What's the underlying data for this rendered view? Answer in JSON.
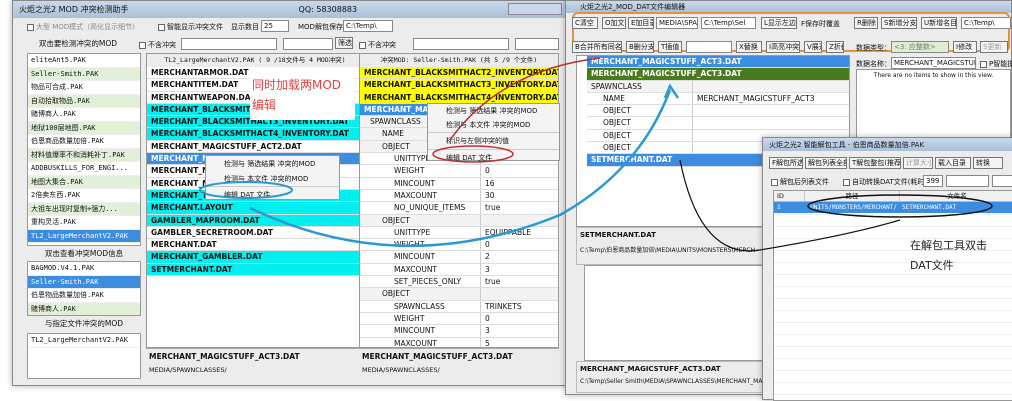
{
  "win1": {
    "title": "火炬之光2 MOD 冲突检测助手",
    "qq": "QQ: 58308883",
    "opt_large": "大型 MOD模式（简化显示细节）",
    "opt_smart": "智能显示冲突文件",
    "show_count_label": "显示数目",
    "show_count": "25",
    "cache_label": "MOD解包保存目录",
    "cache_dir": "C:\\Temp\\",
    "left_header1": "双击要检测冲突的MOD",
    "mods": [
      {
        "t": "eliteAnt5.PAK",
        "g": false
      },
      {
        "t": "Seller-Smith.PAK",
        "g": true
      },
      {
        "t": "物品可合成.PAK",
        "g": false
      },
      {
        "t": "自动拾取物品.PAK",
        "g": true
      },
      {
        "t": "赌博商人.PAK",
        "g": false
      },
      {
        "t": "地狱100层地图.PAK",
        "g": true
      },
      {
        "t": "伯恩商品数量加倍.PAK",
        "g": false
      },
      {
        "t": "材料值爆率不和消耗补丁.PAK",
        "g": true
      },
      {
        "t": "ADDBUSKILLS_FOR_ENGI...",
        "g": false
      },
      {
        "t": "地图大集合.PAK",
        "g": true
      },
      {
        "t": "2倍卖东西.PAK",
        "g": false
      },
      {
        "t": "大祖车出现时复制+强力...",
        "g": true
      },
      {
        "t": "重构灵活.PAK",
        "g": false
      },
      {
        "t": "TL2_LargeMerchantV2.PAK",
        "sel": true
      }
    ],
    "left_header2": "双击查看冲突MOD信息",
    "conflicts": [
      {
        "t": "BAGMOD.V4.1.PAK"
      },
      {
        "t": "Seller-Smith.PAK",
        "sel": true
      },
      {
        "t": "伯恩物品数量加倍.PAK"
      },
      {
        "t": "赌博商人.PAK",
        "g": true
      }
    ],
    "left_header3": "与指定文件冲突的MOD",
    "file_conflicts": [
      "TL2_LargeMerchantV2.PAK"
    ],
    "no_conflict": "不含冲突",
    "filter_btn": "筛选",
    "mid_header": "TL2_LargeMerchantV2.PAK ( 9 /18文件与 4 MOD冲突)",
    "mid_rows": [
      {
        "t": "MERCHANTARMOR.DAT",
        "c": ""
      },
      {
        "t": "MERCHANTITEM.DAT",
        "c": ""
      },
      {
        "t": "MERCHANTWEAPON.DAT",
        "c": ""
      },
      {
        "t": "MERCHANT_BLACKSMITHACT2_INVENTORY.DAT",
        "c": "c"
      },
      {
        "t": "MERCHANT_BLACKSMITHACT3_INVENTORY.DAT",
        "c": "c"
      },
      {
        "t": "MERCHANT_BLACKSMITHACT4_INVENTORY.DAT",
        "c": "c"
      },
      {
        "t": "MERCHANT_MAGICSTUFF_ACT2.DAT",
        "c": ""
      },
      {
        "t": "MERCHANT_MAGICSTUFF_ACT3.DAT",
        "c": "b"
      },
      {
        "t": "MERCHANT_MAPROOM.DAT",
        "c": ""
      },
      {
        "t": "MERCHANT_MAP_...",
        "c": ""
      },
      {
        "t": "MERCHANT_THEOSOPHY.DAT",
        "c": "c"
      },
      {
        "t": "MERCHANT.LAYOUT",
        "c": "c"
      },
      {
        "t": "GAMBLER_MAPROOM.DAT",
        "c": "c"
      },
      {
        "t": "GAMBLER_SECRETROOM.DAT",
        "c": ""
      },
      {
        "t": "MERCHANT.DAT",
        "c": ""
      },
      {
        "t": "MERCHANT_GAMBLER.DAT",
        "c": "c"
      },
      {
        "t": "SETMERCHANT.DAT",
        "c": "c"
      }
    ],
    "mid_info_file": "MERCHANT_MAGICSTUFF_ACT3.DAT",
    "mid_info_path": "MEDIA/SPAWNCLASSES/",
    "ctx1": [
      "检测与 筛选结果 冲突的MOD",
      "检测与 本文件 冲突的MOD",
      "编辑 DAT 文件"
    ],
    "right_header": "冲突MOD: Seller-Smith.PAK (共 5 /9 个文件)",
    "right_rows": [
      {
        "t": "MERCHANT_BLACKSMITHACT2_INVENTORY.DAT",
        "c": "y"
      },
      {
        "t": "MERCHANT_BLACKSMITHACT3_INVENTORY.DAT",
        "c": "y"
      },
      {
        "t": "MERCHANT_BLACKSMITHACT4_INVENTORY.DAT",
        "c": "y"
      },
      {
        "t": "MERCHANT_MAGICSTUFF_ACT3.DAT",
        "c": "b"
      }
    ],
    "tree": [
      [
        "SPAWNCLASS",
        "",
        0,
        "-"
      ],
      [
        "NAME",
        "",
        1,
        ""
      ],
      [
        "OBJECT",
        "",
        1,
        "-"
      ],
      [
        "UNITTYPE",
        "",
        2,
        ""
      ],
      [
        "WEIGHT",
        "0",
        2,
        ""
      ],
      [
        "MINCOUNT",
        "16",
        2,
        ""
      ],
      [
        "MAXCOUNT",
        "30",
        2,
        ""
      ],
      [
        "NO_UNIQUE_ITEMS",
        "true",
        2,
        ""
      ],
      [
        "OBJECT",
        "",
        1,
        "-"
      ],
      [
        "UNITTYPE",
        "EQUIPPABLE",
        2,
        ""
      ],
      [
        "WEIGHT",
        "0",
        2,
        ""
      ],
      [
        "MINCOUNT",
        "2",
        2,
        ""
      ],
      [
        "MAXCOUNT",
        "3",
        2,
        ""
      ],
      [
        "SET_PIECES_ONLY",
        "true",
        2,
        ""
      ],
      [
        "OBJECT",
        "",
        1,
        "-"
      ],
      [
        "SPAWNCLASS",
        "TRINKETS",
        2,
        ""
      ],
      [
        "WEIGHT",
        "0",
        2,
        ""
      ],
      [
        "MINCOUNT",
        "3",
        2,
        ""
      ],
      [
        "MAXCOUNT",
        "5",
        2,
        ""
      ]
    ],
    "ctx2": [
      "检测与 筛选结果 冲突的MOD",
      "检测与 本文件 冲突的MOD",
      "标识与左侧冲突的值",
      "编辑 DAT 文件"
    ],
    "right_info_file": "MERCHANT_MAGICSTUFF_ACT3.DAT",
    "right_info_path": "MEDIA/SPAWNCLASSES/"
  },
  "win2": {
    "title": "火炬之光2_MOD_DAT文件编辑器",
    "tb1": [
      "C清空",
      "O加文件",
      "E加目录",
      "MEDIA\\SPA",
      "C:\\Temp\\Sel",
      "L显示左边",
      "F保存时覆盖",
      "R删除",
      "S新增分支",
      "U新增名目",
      "C:\\Temp\\"
    ],
    "tb2": [
      "B合并所有同名",
      "B删分支",
      "T插值",
      "X替换",
      "I高亮冲突",
      "V展开",
      "Z折叠"
    ],
    "data_type_label": "数据类型：",
    "data_type_value": "<3: 应整数>",
    "change_btn": "I修改",
    "new_btn": "S更新",
    "data_name_label": "数据名称：",
    "data_name_value": "MERCHANT_MAGICSTUFF_A",
    "smart_label": "P智能提示",
    "empty_msg": "There are no items to show in this view.",
    "tree": [
      {
        "t": "MERCHANT_MAGICSTUFF_ACT3.DAT",
        "c": "b",
        "e": "+"
      },
      {
        "t": "MERCHANT_MAGICSTUFF_ACT3.DAT",
        "c": "dg",
        "e": "-"
      },
      {
        "k": "SPAWNCLASS",
        "v": "",
        "e": "-",
        "lvl": 0
      },
      {
        "k": "NAME",
        "v": "MERCHANT_MAGICSTUFF_ACT3",
        "e": "",
        "lvl": 1
      },
      {
        "k": "OBJECT",
        "v": "",
        "e": "+",
        "lvl": 1
      },
      {
        "k": "OBJECT",
        "v": "",
        "e": "+",
        "lvl": 1
      },
      {
        "k": "OBJECT",
        "v": "",
        "e": "+",
        "lvl": 1
      },
      {
        "k": "OBJECT",
        "v": "",
        "e": "+",
        "lvl": 1
      },
      {
        "t": "SETMERCHANT.DAT",
        "c": "b",
        "e": "+"
      }
    ],
    "info1_file": "SETMERCHANT.DAT",
    "info1_path": "C:\\Temp\\伯恩商品数量加倍\\MEDIA\\UNITS\\MONSTERS\\MERCH",
    "info2_file": "MERCHANT_MAGICSTUFF_ACT3.DAT",
    "info2_path": "C:\\Temp\\Seller Smith\\MEDIA\\SPAWNCLASSES\\MERCHANT_MA"
  },
  "win3": {
    "title": "火炬之光2 智能解包工具  -  伯恩商品数量加倍.PAK",
    "tb": [
      "F解包所选",
      "解包列表全部",
      "T解包整包(推荐)",
      "计算大小",
      "载入目录",
      "转换"
    ],
    "chk1": "解包后列表文件",
    "chk2": "自动转换DAT文件(耗时)",
    "num": "399",
    "cols": [
      "ID",
      "路径",
      "文件名"
    ],
    "rows": [
      [
        "1",
        "UNITS/MONSTERS/MERCHANT/",
        "SETMERCHANT.DAT"
      ]
    ]
  },
  "annotations": {
    "a1": "同时加载两MOD",
    "a1b": "编辑",
    "a2": "在解包工具双击",
    "a2b": "DAT文件"
  },
  "colors": {
    "cyan": "#00f0f0",
    "yellow": "#ffff00",
    "select": "#3c8de0",
    "dark_green": "#4a7a20",
    "annot_red": "#e04040",
    "orange": "#e8903a",
    "arrow_blue": "#2a9ad0"
  }
}
